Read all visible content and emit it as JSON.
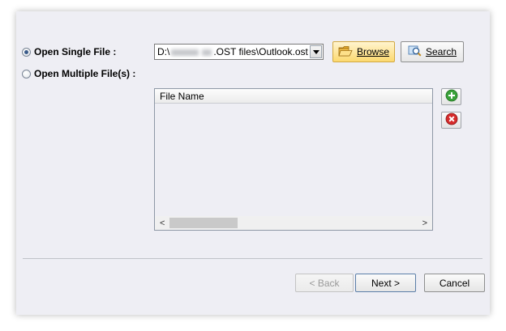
{
  "options": {
    "single_label": "Open Single File :",
    "multiple_label": "Open Multiple File(s) :"
  },
  "path": {
    "prefix": "D:\\",
    "suffix": ".OST files\\Outlook.ost"
  },
  "buttons": {
    "browse": "Browse",
    "search": "Search",
    "back": "< Back",
    "next": "Next >",
    "cancel": "Cancel"
  },
  "list": {
    "column_header": "File Name",
    "rows": []
  },
  "icons": {
    "browse": "folder-icon",
    "search": "search-icon",
    "add": "add-icon",
    "remove": "remove-icon"
  },
  "colors": {
    "browse_bg": "#fcd96f",
    "add_green": "#3aa23a",
    "remove_red": "#d62b2b"
  }
}
